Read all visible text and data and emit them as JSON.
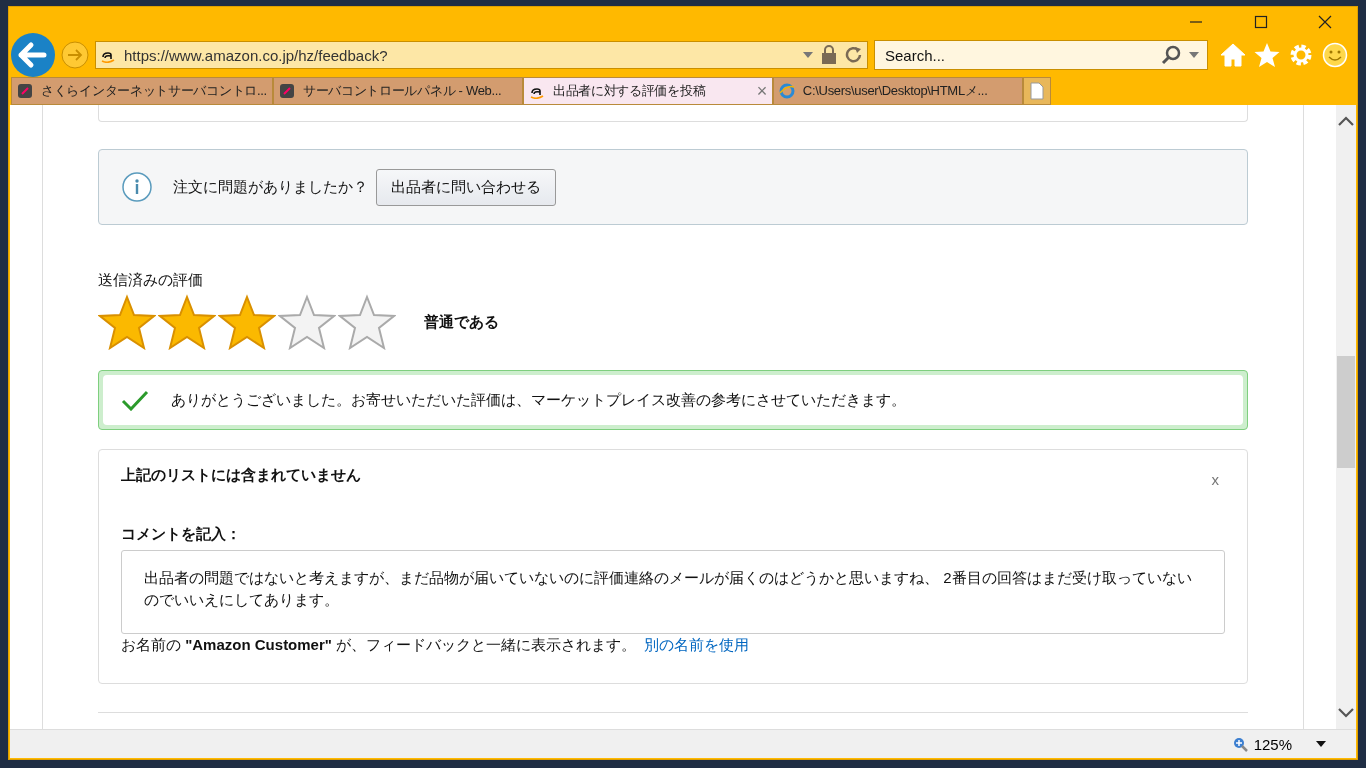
{
  "browser": {
    "address": "https://www.amazon.co.jp/hz/feedback?",
    "search_placeholder": "Search...",
    "tabs": [
      {
        "label": "さくらインターネットサーバコントロ...",
        "selected": false,
        "kind": "sakura"
      },
      {
        "label": "サーバコントロールパネル - Web...",
        "selected": false,
        "kind": "sakura"
      },
      {
        "label": "出品者に対する評価を投稿",
        "selected": true,
        "kind": "amazon"
      },
      {
        "label": "C:\\Users\\user\\Desktop\\HTMLメ...",
        "selected": false,
        "kind": "ie"
      }
    ],
    "tab_close": "×"
  },
  "info_box": {
    "text": "注文に問題がありましたか？",
    "button": "出品者に問い合わせる"
  },
  "rating": {
    "heading": "送信済みの評価",
    "stars": 3,
    "label": "普通である"
  },
  "thanks": {
    "text": "ありがとうございました。お寄せいただいた評価は、マーケットプレイス改善の参考にさせていただきます。"
  },
  "comment_card": {
    "title": "上記のリストには含まれていません",
    "close": "x",
    "comment_label": "コメントを記入：",
    "comment": "出品者の問題ではないと考えますが、まだ品物が届いていないのに評価連絡のメールが届くのはどうかと思いますね、 2番目の回答はまだ受け取っていないのでいいえにしてあります。",
    "name_note": "お名前の **\"Amazon Customer\"** が、フィードバックと一緒に表示されます。",
    "name_link": "別の名前を使用"
  },
  "status_bar": {
    "zoom": "125%"
  }
}
